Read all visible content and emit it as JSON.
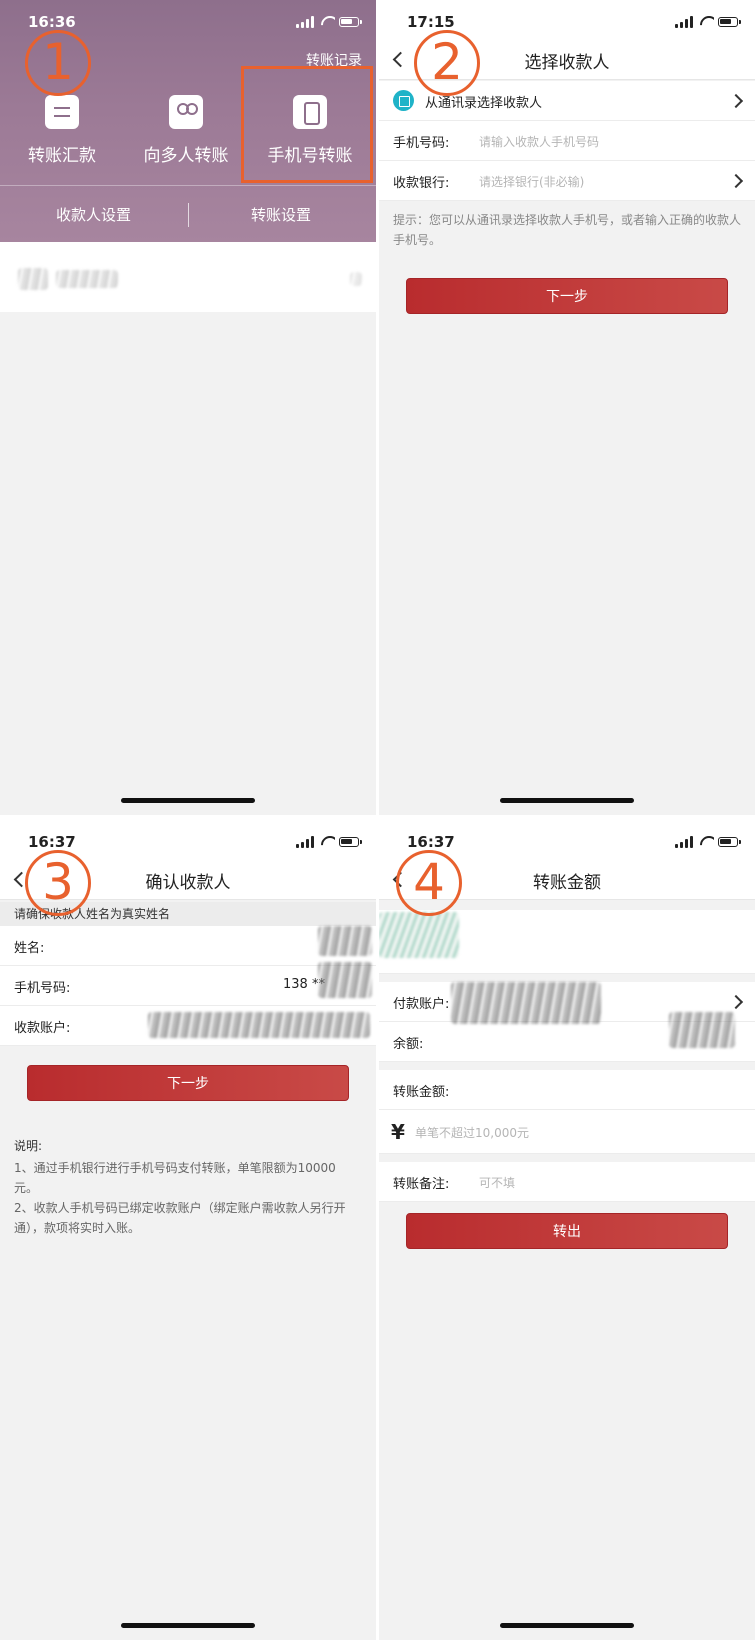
{
  "screens": [
    {
      "step": "1",
      "time": "16:36",
      "record_link": "转账记录",
      "actions": [
        {
          "label": "转账汇款",
          "icon": "swap-arrows-icon"
        },
        {
          "label": "向多人转账",
          "icon": "multiple-users-icon"
        },
        {
          "label": "手机号转账",
          "icon": "phone-icon"
        }
      ],
      "links": [
        "收款人设置",
        "转账设置"
      ]
    },
    {
      "step": "2",
      "time": "17:15",
      "title": "选择收款人",
      "contacts_row": "从通讯录选择收款人",
      "phone_label": "手机号码:",
      "phone_placeholder": "请输入收款人手机号码",
      "bank_label": "收款银行:",
      "bank_placeholder": "请选择银行(非必输)",
      "hint": "提示：您可以从通讯录选择收款人手机号，或者输入正确的收款人手机号。",
      "next_button": "下一步"
    },
    {
      "step": "3",
      "time": "16:37",
      "title": "确认收款人",
      "warning": "请确保收款人姓名为真实姓名",
      "name_label": "姓名:",
      "phone_label": "手机号码:",
      "phone_value": "138 **",
      "account_label": "收款账户:",
      "next_button": "下一步",
      "notes_title": "说明:",
      "notes": [
        "1、通过手机银行进行手机号码支付转账，单笔限额为10000元。",
        "2、收款人手机号码已绑定收款账户（绑定账户需收款人另行开通），款项将实时入账。"
      ]
    },
    {
      "step": "4",
      "time": "16:37",
      "title": "转账金额",
      "pay_account_label": "付款账户:",
      "balance_label": "余额:",
      "amount_label": "转账金额:",
      "currency_symbol": "¥",
      "amount_placeholder": "单笔不超过10,000元",
      "remark_label": "转账备注:",
      "remark_placeholder": "可不填",
      "submit_button": "转出"
    }
  ],
  "colors": {
    "brand_red": "#b92c2e",
    "annotation_orange": "#e8612e",
    "hero_purple": "#8e6f8c"
  }
}
